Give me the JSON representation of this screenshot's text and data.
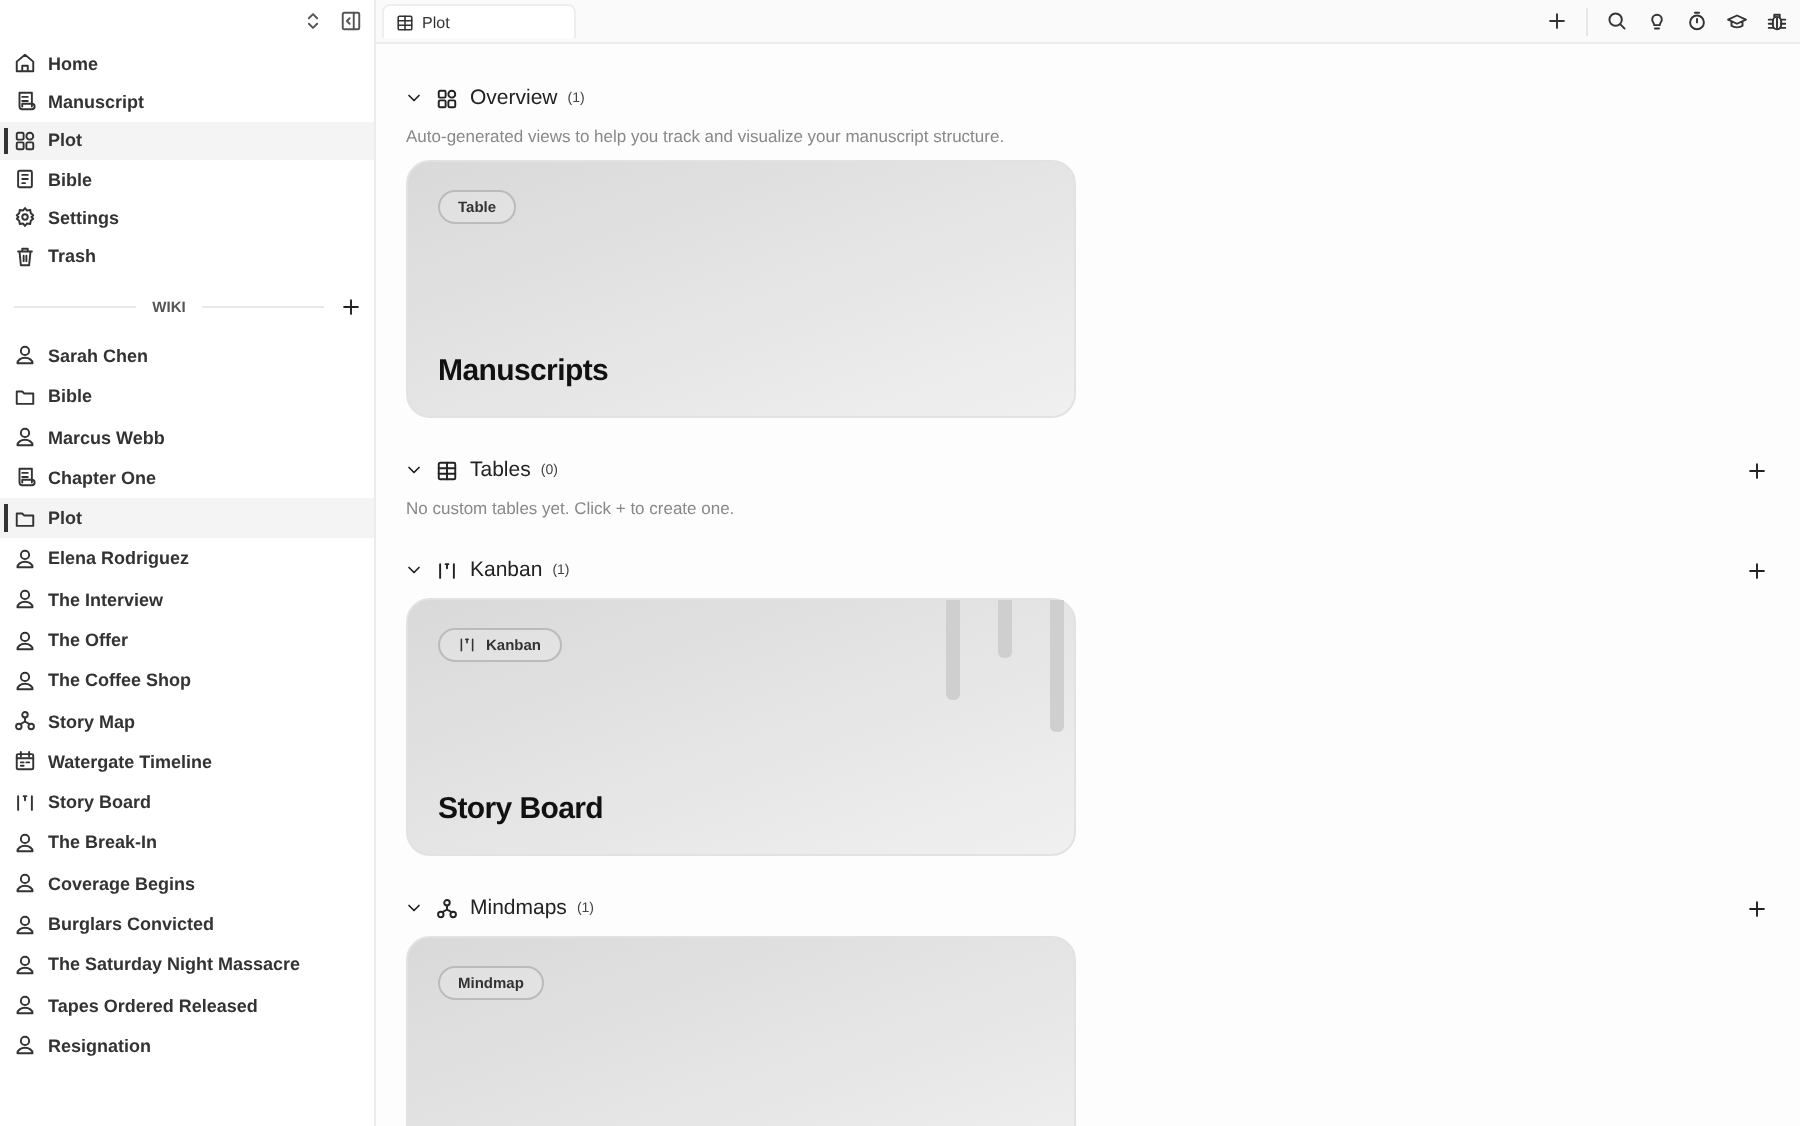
{
  "nav": [
    {
      "label": "Home",
      "kind": "home",
      "selected": false
    },
    {
      "label": "Manuscript",
      "kind": "scroll",
      "selected": false
    },
    {
      "label": "Plot",
      "kind": "grid",
      "selected": true
    },
    {
      "label": "Bible",
      "kind": "book",
      "selected": false
    },
    {
      "label": "Settings",
      "kind": "gear",
      "selected": false
    },
    {
      "label": "Trash",
      "kind": "trash",
      "selected": false
    }
  ],
  "wiki": {
    "title": "WIKI",
    "items": [
      {
        "label": "Sarah Chen",
        "kind": "person",
        "selected": false
      },
      {
        "label": "Bible",
        "kind": "folder",
        "selected": false
      },
      {
        "label": "Marcus Webb",
        "kind": "person",
        "selected": false
      },
      {
        "label": "Chapter One",
        "kind": "scroll",
        "selected": false
      },
      {
        "label": "Plot",
        "kind": "folder",
        "selected": true
      },
      {
        "label": "Elena Rodriguez",
        "kind": "person",
        "selected": false
      },
      {
        "label": "The Interview",
        "kind": "person",
        "selected": false
      },
      {
        "label": "The Offer",
        "kind": "person",
        "selected": false
      },
      {
        "label": "The Coffee Shop",
        "kind": "person",
        "selected": false
      },
      {
        "label": "Story Map",
        "kind": "nodes",
        "selected": false
      },
      {
        "label": "Watergate Timeline",
        "kind": "calendar",
        "selected": false
      },
      {
        "label": "Story Board",
        "kind": "kanban",
        "selected": false
      },
      {
        "label": "The Break-In",
        "kind": "person",
        "selected": false
      },
      {
        "label": "Coverage Begins",
        "kind": "person",
        "selected": false
      },
      {
        "label": "Burglars Convicted",
        "kind": "person",
        "selected": false
      },
      {
        "label": "The Saturday Night Massacre",
        "kind": "person",
        "selected": false
      },
      {
        "label": "Tapes Ordered Released",
        "kind": "person",
        "selected": false
      },
      {
        "label": "Resignation",
        "kind": "person",
        "selected": false
      }
    ]
  },
  "tab": {
    "label": "Plot",
    "kind": "table"
  },
  "sections": [
    {
      "title": "Overview",
      "kind": "grid",
      "count": "(1)",
      "expanded": true,
      "addable": false,
      "description": "Auto-generated views to help you track and visualize your manuscript structure.",
      "cards": [
        {
          "tag": "Table",
          "title": "Manuscripts",
          "kind": "table"
        }
      ]
    },
    {
      "title": "Tables",
      "kind": "table",
      "count": "(0)",
      "expanded": true,
      "addable": true,
      "description": "No custom tables yet. Click + to create one."
    },
    {
      "title": "Kanban",
      "kind": "kanban",
      "count": "(1)",
      "expanded": true,
      "addable": true,
      "cards": [
        {
          "tag": "Kanban",
          "title": "Story Board",
          "kind": "kanban"
        }
      ]
    },
    {
      "title": "Mindmaps",
      "kind": "nodes",
      "count": "(1)",
      "expanded": true,
      "addable": true,
      "cards": [
        {
          "tag": "Mindmap",
          "kind": "mindmap"
        }
      ]
    }
  ]
}
